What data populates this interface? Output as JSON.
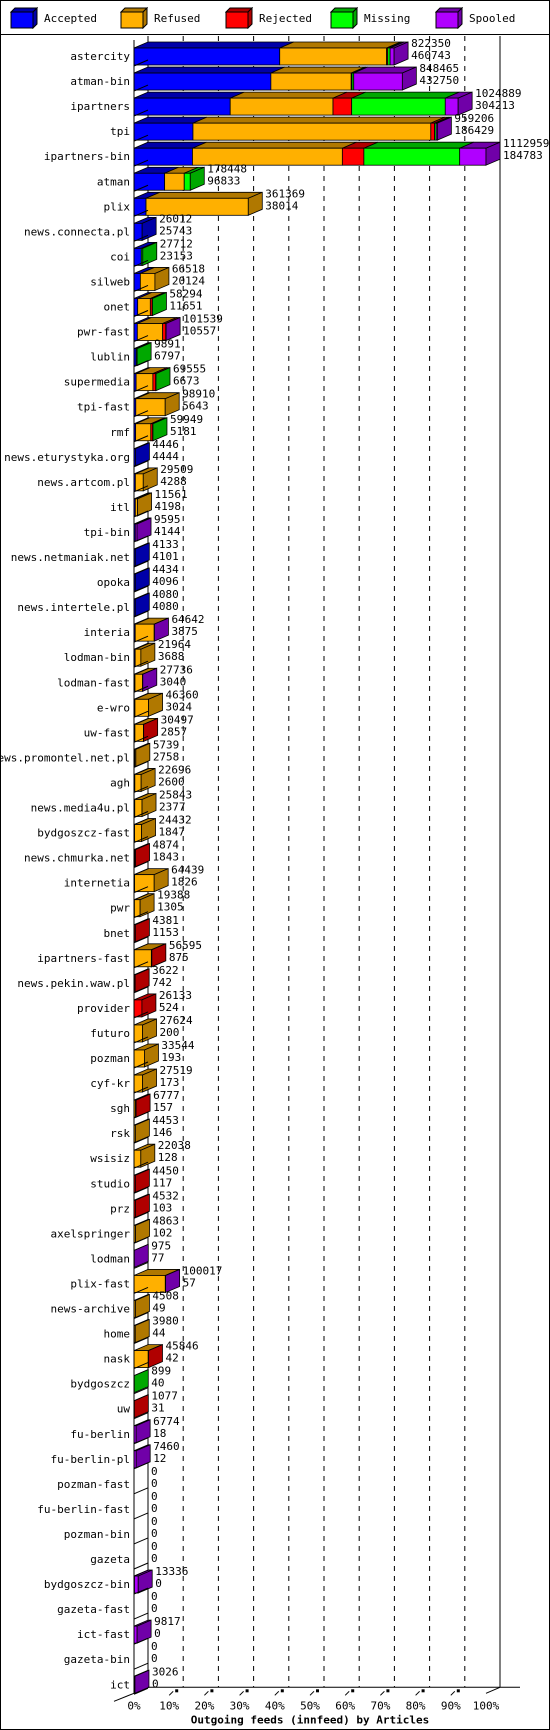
{
  "legend": [
    {
      "name": "Accepted",
      "color": "#0000ff",
      "dark": "#0000a8"
    },
    {
      "name": "Refused",
      "color": "#ffb000",
      "dark": "#b07800"
    },
    {
      "name": "Rejected",
      "color": "#ff0000",
      "dark": "#b00000"
    },
    {
      "name": "Missing",
      "color": "#00ff00",
      "dark": "#00a800"
    },
    {
      "name": "Spooled",
      "color": "#b000ff",
      "dark": "#7000a8"
    }
  ],
  "chart_data": {
    "type": "bar",
    "orientation": "horizontal",
    "stacked": true,
    "style": "3d",
    "title": "",
    "xlabel": "Outgoing feeds (innfeed) by Articles",
    "ylabel": "",
    "xlim": [
      0,
      100
    ],
    "x_unit": "%",
    "x_ticks": [
      "0%",
      "10%",
      "20%",
      "30%",
      "40%",
      "50%",
      "60%",
      "70%",
      "80%",
      "90%",
      "100%"
    ],
    "grid": true,
    "legend_position": "top",
    "scale_max": 1112959,
    "series_names": [
      "Accepted",
      "Refused",
      "Rejected",
      "Missing",
      "Spooled"
    ],
    "bars": [
      {
        "name": "astercity",
        "total": 822350,
        "accepted": 460743,
        "segments": [
          460743,
          338000,
          3500,
          7500,
          12607
        ]
      },
      {
        "name": "atman-bin",
        "total": 848465,
        "accepted": 432750,
        "segments": [
          432750,
          254000,
          2500,
          5500,
          153715
        ]
      },
      {
        "name": "ipartners",
        "total": 1024889,
        "accepted": 304213,
        "segments": [
          304213,
          325000,
          59000,
          296000,
          40676
        ]
      },
      {
        "name": "tpi",
        "total": 959206,
        "accepted": 186429,
        "segments": [
          186429,
          752000,
          12000,
          5000,
          3777
        ]
      },
      {
        "name": "ipartners-bin",
        "total": 1112959,
        "accepted": 184783,
        "segments": [
          184783,
          474000,
          68000,
          303000,
          83176
        ]
      },
      {
        "name": "atman",
        "total": 178448,
        "accepted": 96833,
        "segments": [
          96833,
          62000,
          500,
          19115,
          0
        ]
      },
      {
        "name": "plix",
        "total": 361369,
        "accepted": 38014,
        "segments": [
          38014,
          323355,
          0,
          0,
          0
        ]
      },
      {
        "name": "news.connecta.pl",
        "total": 26012,
        "accepted": 25743,
        "segments": [
          25743,
          0,
          0,
          269,
          0
        ]
      },
      {
        "name": "coi",
        "total": 27712,
        "accepted": 23153,
        "segments": [
          23153,
          0,
          0,
          4559,
          0
        ]
      },
      {
        "name": "silweb",
        "total": 66518,
        "accepted": 20124,
        "segments": [
          20124,
          46000,
          0,
          394,
          0
        ]
      },
      {
        "name": "onet",
        "total": 58294,
        "accepted": 11651,
        "segments": [
          11651,
          40000,
          6000,
          643,
          0
        ]
      },
      {
        "name": "pwr-fast",
        "total": 101539,
        "accepted": 10557,
        "segments": [
          10557,
          80000,
          10000,
          0,
          982
        ]
      },
      {
        "name": "lublin",
        "total": 9891,
        "accepted": 6797,
        "segments": [
          6797,
          0,
          0,
          3094,
          0
        ]
      },
      {
        "name": "supermedia",
        "total": 69555,
        "accepted": 6673,
        "segments": [
          6673,
          53000,
          9000,
          882,
          0
        ]
      },
      {
        "name": "tpi-fast",
        "total": 98910,
        "accepted": 5643,
        "segments": [
          5643,
          93000,
          0,
          0,
          267
        ]
      },
      {
        "name": "rmf",
        "total": 59949,
        "accepted": 5181,
        "segments": [
          5181,
          48000,
          6000,
          768,
          0
        ]
      },
      {
        "name": "news.eturystyka.org",
        "total": 4446,
        "accepted": 4444,
        "segments": [
          4444,
          0,
          2,
          0,
          0
        ]
      },
      {
        "name": "news.artcom.pl",
        "total": 29509,
        "accepted": 4288,
        "segments": [
          4288,
          25000,
          221,
          0,
          0
        ]
      },
      {
        "name": "itl",
        "total": 11561,
        "accepted": 4198,
        "segments": [
          4198,
          7000,
          363,
          0,
          0
        ]
      },
      {
        "name": "tpi-bin",
        "total": 9595,
        "accepted": 4144,
        "segments": [
          4144,
          0,
          0,
          0,
          5451
        ]
      },
      {
        "name": "news.netmaniak.net",
        "total": 4133,
        "accepted": 4101,
        "segments": [
          4101,
          0,
          0,
          0,
          32
        ]
      },
      {
        "name": "opoka",
        "total": 4434,
        "accepted": 4096,
        "segments": [
          4096,
          0,
          338,
          0,
          0
        ]
      },
      {
        "name": "news.intertele.pl",
        "total": 4080,
        "accepted": 4080,
        "segments": [
          4080,
          0,
          0,
          0,
          0
        ]
      },
      {
        "name": "interia",
        "total": 64642,
        "accepted": 3875,
        "segments": [
          3875,
          60000,
          0,
          0,
          767
        ]
      },
      {
        "name": "lodman-bin",
        "total": 21964,
        "accepted": 3688,
        "segments": [
          3688,
          18000,
          0,
          0,
          276
        ]
      },
      {
        "name": "lodman-fast",
        "total": 27736,
        "accepted": 3040,
        "segments": [
          3040,
          24000,
          0,
          0,
          696
        ]
      },
      {
        "name": "e-wro",
        "total": 46360,
        "accepted": 3024,
        "segments": [
          3024,
          43000,
          0,
          336,
          0
        ]
      },
      {
        "name": "uw-fast",
        "total": 30497,
        "accepted": 2857,
        "segments": [
          2857,
          27000,
          640,
          0,
          0
        ]
      },
      {
        "name": "news.promontel.net.pl",
        "total": 5739,
        "accepted": 2758,
        "segments": [
          2758,
          2981,
          0,
          0,
          0
        ]
      },
      {
        "name": "agh",
        "total": 22696,
        "accepted": 2600,
        "segments": [
          2600,
          20000,
          0,
          0,
          96
        ]
      },
      {
        "name": "news.media4u.pl",
        "total": 25843,
        "accepted": 2377,
        "segments": [
          2377,
          23000,
          0,
          466,
          0
        ]
      },
      {
        "name": "bydgoszcz-fast",
        "total": 24432,
        "accepted": 1847,
        "segments": [
          1847,
          22000,
          0,
          0,
          585
        ]
      },
      {
        "name": "news.chmurka.net",
        "total": 4874,
        "accepted": 1843,
        "segments": [
          1843,
          0,
          3031,
          0,
          0
        ]
      },
      {
        "name": "internetia",
        "total": 64439,
        "accepted": 1826,
        "segments": [
          1826,
          62000,
          0,
          0,
          613
        ]
      },
      {
        "name": "pwr",
        "total": 19388,
        "accepted": 1305,
        "segments": [
          1305,
          18000,
          0,
          83,
          0
        ]
      },
      {
        "name": "bnet",
        "total": 4381,
        "accepted": 1153,
        "segments": [
          1153,
          0,
          3228,
          0,
          0
        ]
      },
      {
        "name": "ipartners-fast",
        "total": 56595,
        "accepted": 875,
        "segments": [
          875,
          54000,
          1500,
          0,
          220
        ]
      },
      {
        "name": "news.pekin.waw.pl",
        "total": 3622,
        "accepted": 742,
        "segments": [
          742,
          0,
          2880,
          0,
          0
        ]
      },
      {
        "name": "provider",
        "total": 26133,
        "accepted": 524,
        "segments": [
          524,
          0,
          25000,
          609,
          0
        ]
      },
      {
        "name": "futuro",
        "total": 27624,
        "accepted": 200,
        "segments": [
          200,
          27000,
          424,
          0,
          0
        ]
      },
      {
        "name": "pozman",
        "total": 33544,
        "accepted": 193,
        "segments": [
          193,
          33000,
          0,
          0,
          351
        ]
      },
      {
        "name": "cyf-kr",
        "total": 27519,
        "accepted": 173,
        "segments": [
          173,
          27000,
          346,
          0,
          0
        ]
      },
      {
        "name": "sgh",
        "total": 6777,
        "accepted": 157,
        "segments": [
          157,
          5000,
          1620,
          0,
          0
        ]
      },
      {
        "name": "rsk",
        "total": 4453,
        "accepted": 146,
        "segments": [
          146,
          4307,
          0,
          0,
          0
        ]
      },
      {
        "name": "wsisiz",
        "total": 22038,
        "accepted": 128,
        "segments": [
          128,
          21500,
          410,
          0,
          0
        ]
      },
      {
        "name": "studio",
        "total": 4450,
        "accepted": 117,
        "segments": [
          117,
          0,
          4333,
          0,
          0
        ]
      },
      {
        "name": "prz",
        "total": 4532,
        "accepted": 103,
        "segments": [
          103,
          0,
          4429,
          0,
          0
        ]
      },
      {
        "name": "axelspringer",
        "total": 4863,
        "accepted": 102,
        "segments": [
          102,
          4761,
          0,
          0,
          0
        ]
      },
      {
        "name": "lodman",
        "total": 975,
        "accepted": 77,
        "segments": [
          77,
          0,
          0,
          0,
          898
        ]
      },
      {
        "name": "plix-fast",
        "total": 100017,
        "accepted": 57,
        "segments": [
          57,
          99000,
          0,
          0,
          960
        ]
      },
      {
        "name": "news-archive",
        "total": 4508,
        "accepted": 49,
        "segments": [
          49,
          4459,
          0,
          0,
          0
        ]
      },
      {
        "name": "home",
        "total": 3980,
        "accepted": 44,
        "segments": [
          44,
          3936,
          0,
          0,
          0
        ]
      },
      {
        "name": "nask",
        "total": 45846,
        "accepted": 42,
        "segments": [
          42,
          45000,
          804,
          0,
          0
        ]
      },
      {
        "name": "bydgoszcz",
        "total": 899,
        "accepted": 40,
        "segments": [
          40,
          0,
          0,
          859,
          0
        ]
      },
      {
        "name": "uw",
        "total": 1077,
        "accepted": 31,
        "segments": [
          31,
          0,
          1046,
          0,
          0
        ]
      },
      {
        "name": "fu-berlin",
        "total": 6774,
        "accepted": 18,
        "segments": [
          18,
          0,
          0,
          0,
          6756
        ]
      },
      {
        "name": "fu-berlin-pl",
        "total": 7460,
        "accepted": 12,
        "segments": [
          12,
          500,
          0,
          0,
          6948
        ]
      },
      {
        "name": "pozman-fast",
        "total": 0,
        "accepted": 0,
        "segments": [
          0,
          0,
          0,
          0,
          0
        ]
      },
      {
        "name": "fu-berlin-fast",
        "total": 0,
        "accepted": 0,
        "segments": [
          0,
          0,
          0,
          0,
          0
        ]
      },
      {
        "name": "pozman-bin",
        "total": 0,
        "accepted": 0,
        "segments": [
          0,
          0,
          0,
          0,
          0
        ]
      },
      {
        "name": "gazeta",
        "total": 0,
        "accepted": 0,
        "segments": [
          0,
          0,
          0,
          0,
          0
        ]
      },
      {
        "name": "bydgoszcz-bin",
        "total": 13336,
        "accepted": 0,
        "segments": [
          0,
          0,
          1500,
          0,
          11836
        ]
      },
      {
        "name": "gazeta-fast",
        "total": 0,
        "accepted": 0,
        "segments": [
          0,
          0,
          0,
          0,
          0
        ]
      },
      {
        "name": "ict-fast",
        "total": 9817,
        "accepted": 0,
        "segments": [
          0,
          0,
          0,
          0,
          9817
        ]
      },
      {
        "name": "gazeta-bin",
        "total": 0,
        "accepted": 0,
        "segments": [
          0,
          0,
          0,
          0,
          0
        ]
      },
      {
        "name": "ict",
        "total": 3026,
        "accepted": 0,
        "segments": [
          0,
          0,
          0,
          0,
          3026
        ]
      }
    ]
  }
}
